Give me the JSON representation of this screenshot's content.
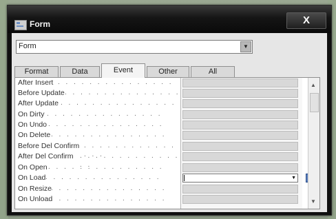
{
  "window": {
    "title": "Form",
    "close_glyph": "X"
  },
  "selector": {
    "value": "Form",
    "dropdown_glyph": "▼"
  },
  "tabs": [
    {
      "label": "Format"
    },
    {
      "label": "Data"
    },
    {
      "label": "Event",
      "active": true
    },
    {
      "label": "Other"
    },
    {
      "label": "All"
    }
  ],
  "properties": [
    {
      "label": "After Insert"
    },
    {
      "label": "Before Update"
    },
    {
      "label": "After Update"
    },
    {
      "label": "On Dirty"
    },
    {
      "label": "On Undo"
    },
    {
      "label": "On Delete"
    },
    {
      "label": "Before Del Confirm"
    },
    {
      "label": "After Del Confirm"
    },
    {
      "label": "On Open"
    },
    {
      "label": "On Load"
    },
    {
      "label": "On Resize"
    },
    {
      "label": "On Unload"
    }
  ],
  "dots": ". . . . . . . . . . . . . . .",
  "editing_cell": {
    "dropdown_glyph": "▼"
  },
  "scrollbar": {
    "up_glyph": "▲",
    "down_glyph": "▼"
  },
  "icons": [
    "form-icon",
    "close-icon",
    "dropdown-arrow-icon",
    "builder-ellipsis-icon"
  ]
}
